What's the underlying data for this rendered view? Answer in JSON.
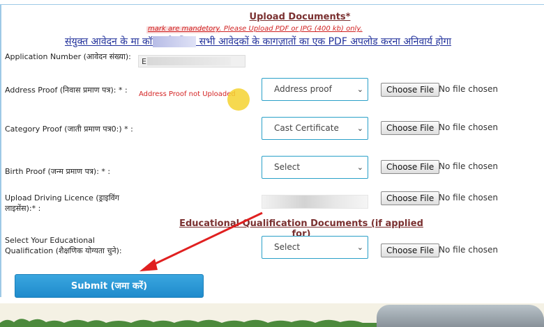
{
  "page": {
    "title": "Upload Documents*",
    "warning": "mark are mandetory. Please Upload PDF or JPG (400 kb) only.",
    "hindi_note": "संयुक्त आवेदन के मा                   कॉलम के लिए, सभी आवेदकों के कागज़ातों का एक PDF अपलोड करना अनिवार्य होगा"
  },
  "fields": {
    "application_number": {
      "label": "Application Number (आवेदन संख्या):",
      "value": "E"
    },
    "address_proof": {
      "label": "Address Proof (निवास प्रमाण पत्र): * :",
      "error": "Address Proof not Uploaded",
      "selected": "Address proof"
    },
    "category_proof": {
      "label": "Category Proof (जाती प्रमाण पत्र0:) * :",
      "selected": "Cast Certificate"
    },
    "birth_proof": {
      "label": "Birth Proof (जन्म प्रमाण पत्र): * :",
      "selected": "Select"
    },
    "driving_licence": {
      "label": "Upload Driving Licence (ड्राइविंग लाइसेंस):* :"
    },
    "education": {
      "label": "Select Your Educational Qualification (शैक्षणिक योग्यता चुने):",
      "selected": "Select"
    }
  },
  "file_input": {
    "button_label": "Choose File",
    "status": "No file chosen"
  },
  "section_heading": "Educational Qualification Documents (if applied for)",
  "submit_label": "Submit (जमा करें)",
  "colors": {
    "accent": "#1f8bcc",
    "error": "#d42424",
    "heading": "#7a3030",
    "annotation_arrow": "#e02020"
  }
}
